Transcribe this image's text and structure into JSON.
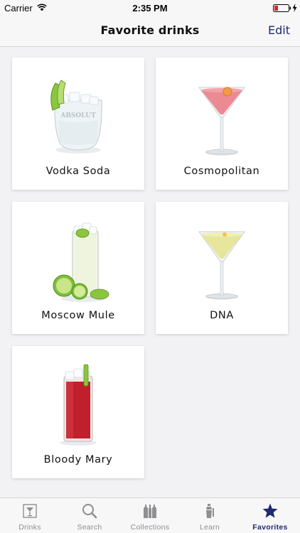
{
  "status": {
    "carrier": "Carrier",
    "time": "2:35 PM"
  },
  "nav": {
    "title": "Favorite drinks",
    "edit_label": "Edit"
  },
  "drinks": [
    {
      "name": "Vodka Soda",
      "icon": "rocks-glass-icon"
    },
    {
      "name": "Cosmopolitan",
      "icon": "martini-glass-icon"
    },
    {
      "name": "Moscow Mule",
      "icon": "highball-glass-icon"
    },
    {
      "name": "DNA",
      "icon": "martini-glass-icon"
    },
    {
      "name": "Bloody Mary",
      "icon": "highball-glass-icon"
    }
  ],
  "tabs": [
    {
      "label": "Drinks",
      "icon": "drinks-glass-icon",
      "active": false
    },
    {
      "label": "Search",
      "icon": "search-icon",
      "active": false
    },
    {
      "label": "Collections",
      "icon": "bottles-icon",
      "active": false
    },
    {
      "label": "Learn",
      "icon": "shaker-icon",
      "active": false
    },
    {
      "label": "Favorites",
      "icon": "star-icon",
      "active": true
    }
  ],
  "colors": {
    "accent": "#1e2a72",
    "inactive_tab": "#8e8e93",
    "background": "#f2f2f4",
    "battery_low": "#e0202a"
  }
}
